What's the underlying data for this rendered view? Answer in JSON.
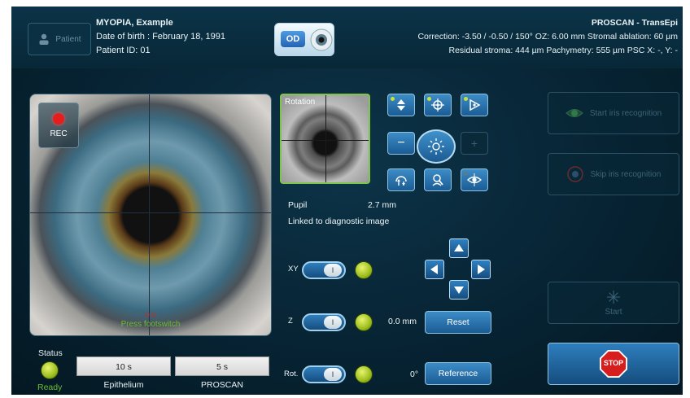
{
  "header": {
    "patient_button": "Patient",
    "patient_name": "MYOPIA, Example",
    "dob": "Date of birth :  February 18, 1991",
    "patient_id": "Patient ID: 01",
    "eye_button": "OD",
    "mode_title": "PROSCAN - TransEpi",
    "line1": "Correction: -3.50 / -0.50 / 150°  OZ: 6.00 mm  Stromal ablation: 60 µm",
    "line2": "Residual stroma: 444 µm  Pachymetry: 555 µm   PSC X: -, Y: -"
  },
  "video": {
    "rec_label": "REC",
    "foot_indicator": "0  0",
    "press_footswitch": "Press footswitch"
  },
  "rotation": {
    "label": "Rotation"
  },
  "pupil": {
    "label": "Pupil",
    "value": "2.7 mm"
  },
  "linked_text": "Linked to diagnostic image",
  "controls": {
    "xy_label": "XY",
    "z_label": "Z",
    "rot_label": "Rot.",
    "toggle_on": "I",
    "z_value": "0.0 mm",
    "rot_value": "0°",
    "reset_button": "Reset",
    "reference_button": "Reference",
    "minus": "−",
    "plus": "+"
  },
  "right_panel": {
    "start_iris": "Start iris recognition",
    "skip_iris": "Skip iris recognition",
    "start": "Start",
    "stop": "STOP"
  },
  "status": {
    "label": "Status",
    "state": "Ready",
    "epithelium_time": "10 s",
    "epithelium_label": "Epithelium",
    "proscan_time": "5 s",
    "proscan_label": "PROSCAN"
  },
  "colors": {
    "accent_blue": "#2f7fbd",
    "ready_green": "#6bbd34",
    "rec_red": "#e51d1d",
    "led_green": "#c4e13a"
  }
}
